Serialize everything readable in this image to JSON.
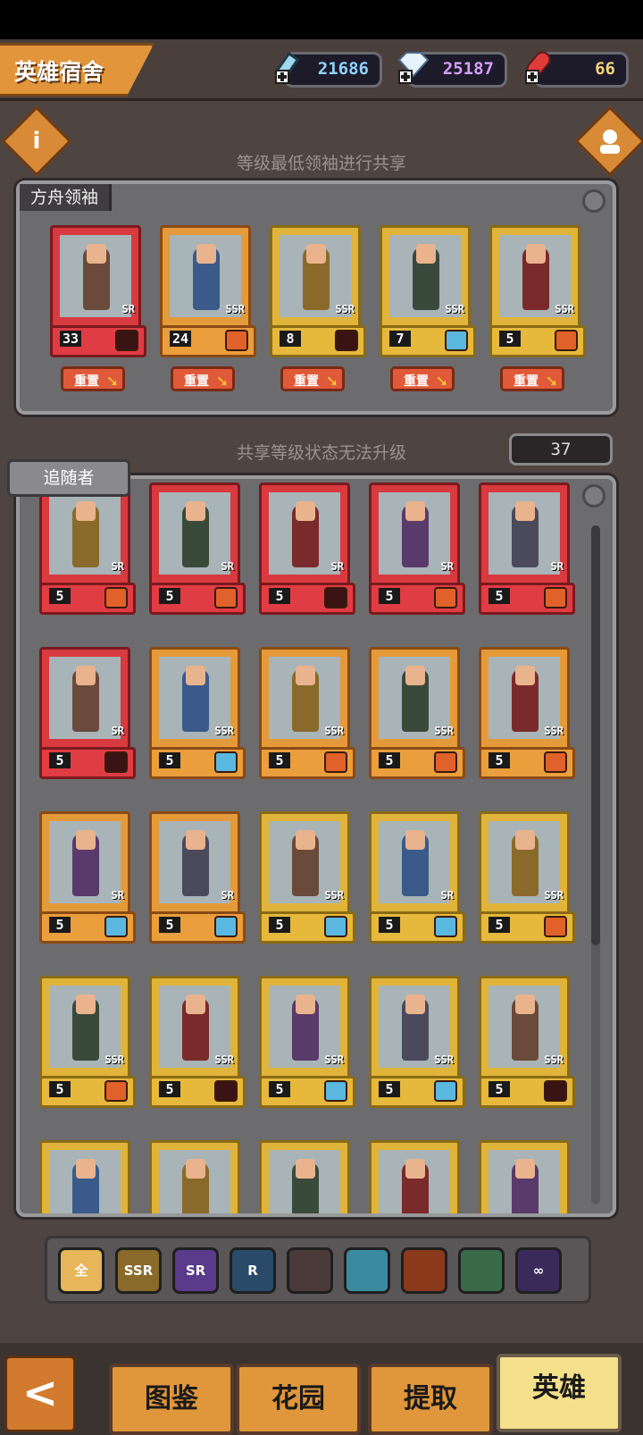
{
  "header": {
    "title": "英雄宿舍",
    "resources": [
      {
        "icon": "syringe-icon",
        "value": "21686",
        "color": "#8fd3ff"
      },
      {
        "icon": "diamond-icon",
        "value": "25187",
        "color": "#d99bff"
      },
      {
        "icon": "pill-icon",
        "value": "66",
        "color": "#f2d37a"
      }
    ]
  },
  "info_button_label": "i",
  "leader_caption": "等级最低领袖进行共享",
  "leaders_panel": {
    "title": "方舟领袖",
    "reset_label": "重置",
    "cards": [
      {
        "level": "33",
        "rarity": "SR",
        "color": "red",
        "faction": "red-faction-icon"
      },
      {
        "level": "24",
        "rarity": "SSR",
        "color": "orange",
        "faction": "dragon-faction-icon"
      },
      {
        "level": "8",
        "rarity": "SSR",
        "color": "gold",
        "faction": "red-faction-icon"
      },
      {
        "level": "7",
        "rarity": "SSR",
        "color": "gold",
        "faction": "wolf-faction-icon"
      },
      {
        "level": "5",
        "rarity": "SSR",
        "color": "gold",
        "faction": "dragon-faction-icon"
      }
    ]
  },
  "shared_caption": "共享等级状态无法升级",
  "follower_count": "37",
  "followers_panel": {
    "title": "追随者",
    "rows": [
      [
        {
          "level": "5",
          "rarity": "SR",
          "color": "red",
          "faction": "dragon-faction-icon"
        },
        {
          "level": "5",
          "rarity": "SR",
          "color": "red",
          "faction": "dragon-faction-icon"
        },
        {
          "level": "5",
          "rarity": "SR",
          "color": "red",
          "faction": "red-faction-icon"
        },
        {
          "level": "5",
          "rarity": "SR",
          "color": "red",
          "faction": "dragon-faction-icon"
        },
        {
          "level": "5",
          "rarity": "SR",
          "color": "red",
          "faction": "dragon-faction-icon"
        }
      ],
      [
        {
          "level": "5",
          "rarity": "SR",
          "color": "red",
          "faction": "red-faction-icon"
        },
        {
          "level": "5",
          "rarity": "SSR",
          "color": "orange",
          "faction": "wolf-faction-icon"
        },
        {
          "level": "5",
          "rarity": "SSR",
          "color": "orange",
          "faction": "dragon-faction-icon"
        },
        {
          "level": "5",
          "rarity": "SSR",
          "color": "orange",
          "faction": "dragon-faction-icon"
        },
        {
          "level": "5",
          "rarity": "SSR",
          "color": "orange",
          "faction": "dragon-faction-icon"
        }
      ],
      [
        {
          "level": "5",
          "rarity": "SR",
          "color": "orange",
          "faction": "wolf-faction-icon"
        },
        {
          "level": "5",
          "rarity": "SR",
          "color": "orange",
          "faction": "wolf-faction-icon"
        },
        {
          "level": "5",
          "rarity": "SSR",
          "color": "gold",
          "faction": "wolf-faction-icon"
        },
        {
          "level": "5",
          "rarity": "SR",
          "color": "gold",
          "faction": "wolf-faction-icon"
        },
        {
          "level": "5",
          "rarity": "SSR",
          "color": "gold",
          "faction": "dragon-faction-icon"
        }
      ],
      [
        {
          "level": "5",
          "rarity": "SSR",
          "color": "gold",
          "faction": "dragon-faction-icon"
        },
        {
          "level": "5",
          "rarity": "SSR",
          "color": "gold",
          "faction": "red-faction-icon"
        },
        {
          "level": "5",
          "rarity": "SSR",
          "color": "gold",
          "faction": "wolf-faction-icon"
        },
        {
          "level": "5",
          "rarity": "SSR",
          "color": "gold",
          "faction": "wolf-faction-icon"
        },
        {
          "level": "5",
          "rarity": "SSR",
          "color": "gold",
          "faction": "red-faction-icon"
        }
      ],
      [
        {
          "level": "",
          "rarity": "",
          "color": "gold",
          "faction": ""
        },
        {
          "level": "",
          "rarity": "",
          "color": "gold",
          "faction": ""
        },
        {
          "level": "",
          "rarity": "",
          "color": "gold",
          "faction": ""
        },
        {
          "level": "",
          "rarity": "",
          "color": "gold",
          "faction": ""
        },
        {
          "level": "",
          "rarity": "",
          "color": "gold",
          "faction": ""
        }
      ]
    ]
  },
  "filters": [
    {
      "name": "filter-all",
      "label": "全",
      "color": "#e7b55a"
    },
    {
      "name": "filter-ssr",
      "label": "SSR",
      "color": "#8a6a2a"
    },
    {
      "name": "filter-sr",
      "label": "SR",
      "color": "#5a3a8a"
    },
    {
      "name": "filter-r",
      "label": "R",
      "color": "#2a4a6a"
    },
    {
      "name": "filter-faction-red",
      "label": "",
      "color": "#4a3a3a"
    },
    {
      "name": "filter-faction-wolf",
      "label": "",
      "color": "#3a8aa0"
    },
    {
      "name": "filter-faction-dragon",
      "label": "",
      "color": "#8a3a1a"
    },
    {
      "name": "filter-faction-feather",
      "label": "",
      "color": "#3a6a4a"
    },
    {
      "name": "filter-faction-infinity",
      "label": "∞",
      "color": "#3a2a5a"
    }
  ],
  "bottom_nav": {
    "back_label": "<",
    "tabs": [
      {
        "label": "图鉴",
        "active": false
      },
      {
        "label": "花园",
        "active": false
      },
      {
        "label": "提取",
        "active": false
      },
      {
        "label": "英雄",
        "active": true
      }
    ]
  }
}
